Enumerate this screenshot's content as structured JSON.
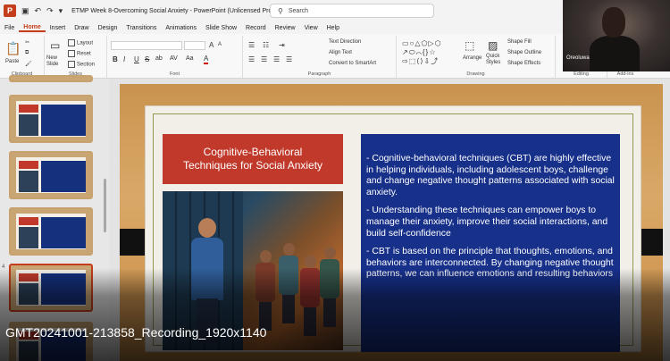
{
  "titlebar": {
    "app_icon": "P",
    "file_label": "File",
    "title": "ETMP Week 8-Overcoming Social Anxiety  -  PowerPoint (Unlicensed Prod...",
    "search_placeholder": "Search"
  },
  "menu": {
    "tabs": [
      "File",
      "Home",
      "Insert",
      "Draw",
      "Design",
      "Transitions",
      "Animations",
      "Slide Show",
      "Record",
      "Review",
      "View",
      "Help"
    ],
    "active": "Home"
  },
  "ribbon": {
    "clipboard": {
      "paste": "Paste",
      "label": "Clipboard"
    },
    "slides": {
      "new_slide": "New Slide",
      "layout": "Layout",
      "reset": "Reset",
      "section": "Section",
      "label": "Slides"
    },
    "font": {
      "label": "Font",
      "bold": "B",
      "italic": "I",
      "underline": "U",
      "strike": "S",
      "shadow": "ab",
      "spacing": "AV",
      "case": "Aa",
      "font_color": "A",
      "grow": "A",
      "shrink": "A"
    },
    "paragraph": {
      "label": "Paragraph",
      "text_direction": "Text Direction",
      "align_text": "Align Text",
      "smartart": "Convert to SmartArt"
    },
    "drawing": {
      "label": "Drawing",
      "arrange": "Arrange",
      "quick_styles": "Quick Styles",
      "shape_fill": "Shape Fill",
      "shape_outline": "Shape Outline",
      "shape_effects": "Shape Effects"
    },
    "editing": {
      "label": "Editing"
    },
    "addins": {
      "label": "Add-ins"
    }
  },
  "webcam": {
    "participant": "Oreoluwa"
  },
  "thumbnails": [
    {
      "num": "",
      "selected": false
    },
    {
      "num": "",
      "selected": false
    },
    {
      "num": "",
      "selected": false
    },
    {
      "num": "4",
      "selected": true
    }
  ],
  "slide": {
    "title_line1": "Cognitive-Behavioral",
    "title_line2": "Techniques for Social Anxiety",
    "bullets": [
      "- Cognitive-behavioral techniques (CBT) are highly effective in helping individuals, including adolescent boys, challenge and change negative thought patterns associated with social anxiety.",
      "- Understanding these techniques can empower boys to manage their anxiety, improve their social interactions, and build self-confidence",
      "- CBT is based on the principle that thoughts, emotions, and behaviors are interconnected. By changing negative thought patterns, we can influence emotions and resulting behaviors"
    ]
  },
  "recording": {
    "filename": "GMT20241001-213858_Recording_1920x1140"
  },
  "colors": {
    "accent": "#c43e1c",
    "title_box": "#c0392b",
    "text_box": "#17308a"
  }
}
